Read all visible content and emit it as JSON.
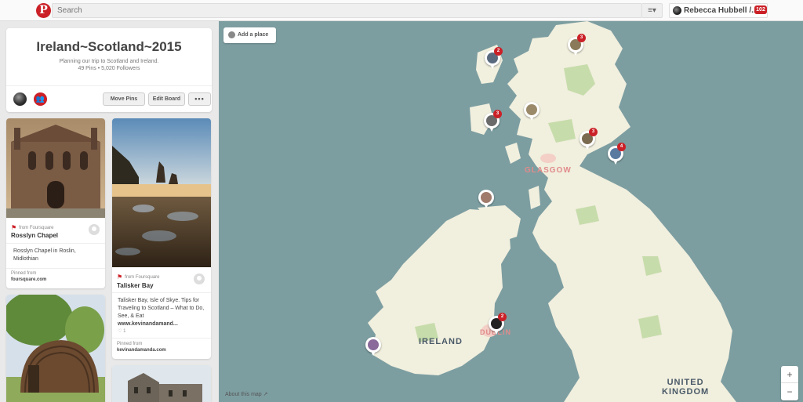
{
  "header": {
    "search_placeholder": "Search",
    "search_menu_icon": "≡▾",
    "user_name": "Rebecca Hubbell /...",
    "notifications": "102"
  },
  "board": {
    "title": "Ireland~Scotland~2015",
    "description": "Planning our trip to Scotland and Ireland.",
    "stats": "49 Pins  •  5,020 Followers",
    "move_pins": "Move Pins",
    "edit_board": "Edit Board",
    "more": "•••"
  },
  "pins": [
    {
      "source": "from Foursquare",
      "place": "Rosslyn Chapel",
      "description": "Rosslyn Chapel in Roslin, Midlothian",
      "pinned_from_label": "Pinned from",
      "pinned_from": "foursquare.com"
    },
    {
      "source": "from Foursquare",
      "place": "Talisker Bay",
      "description": "Talisker Bay, Isle of Skye. Tips for Traveling to Scotland – What to Do, See, & Eat",
      "link": "www.kevinandamand...",
      "likes": "1",
      "pinned_from_label": "Pinned from",
      "pinned_from": "kevinandamanda.com"
    }
  ],
  "map": {
    "add_place": "Add a place",
    "labels": {
      "glasgow": "GLASGOW",
      "ireland": "IRELAND",
      "dublin": "DUBLIN",
      "uk_line1": "UNITED",
      "uk_line2": "KINGDOM"
    },
    "markers": [
      {
        "count": "3"
      },
      {
        "count": "2"
      },
      {
        "count": ""
      },
      {
        "count": "3"
      },
      {
        "count": "3"
      },
      {
        "count": "4"
      },
      {
        "count": ""
      },
      {
        "count": "2"
      },
      {
        "count": ""
      }
    ],
    "about": "About this map ↗",
    "zoom_in": "+",
    "zoom_out": "−"
  },
  "colors": {
    "brand_red": "#cb2027",
    "water": "#7d9ea1",
    "land": "#f1efde",
    "park": "#c7dcab"
  }
}
